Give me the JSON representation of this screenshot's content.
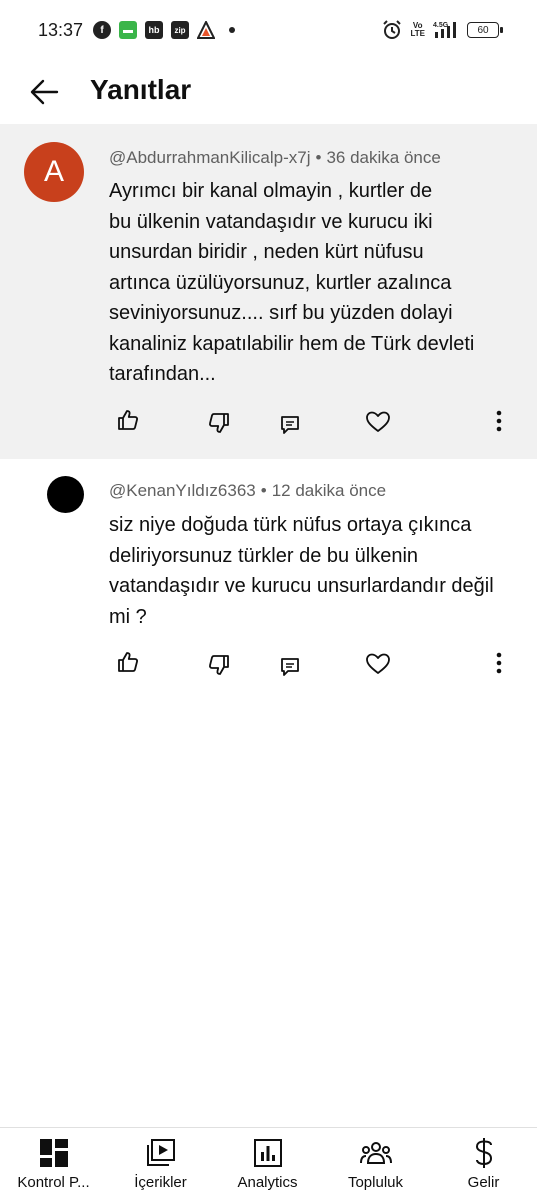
{
  "status_bar": {
    "time": "13:37",
    "battery": "60",
    "network": "4.5G",
    "volte": "Vo LTE"
  },
  "header": {
    "title": "Yanıtlar"
  },
  "comments": [
    {
      "avatar_letter": "A",
      "avatar_color": "#c8401c",
      "author": "@AbdurrahmanKilicalp-x7j",
      "separator": "•",
      "time": "36 dakika önce",
      "lines": [
        "Ayrımcı bir kanal olmayin , kurtler de",
        "bu ülkenin vatandaşıdır ve kurucu iki",
        "unsurdan biridir , neden kürt nüfusu",
        "artınca üzülüyorsunuz,  kurtler azalınca",
        "seviniyorsunuz.... sırf bu yüzden dolayi",
        "kanaliniz kapatılabilir hem de Türk devleti",
        "tarafından..."
      ]
    },
    {
      "avatar_letter": "",
      "avatar_color": "#000000",
      "author": "@KenanYıldız6363",
      "separator": "•",
      "time": "12 dakika önce",
      "lines": [
        "siz niye doğuda türk nüfus ortaya çıkınca",
        "deliriyorsunuz türkler de bu ülkenin",
        "vatandaşıdır ve kurucu unsurlardandır değil",
        "mi ?"
      ]
    }
  ],
  "bottom_nav": [
    {
      "label": "Kontrol P...",
      "icon": "dashboard-icon"
    },
    {
      "label": "İçerikler",
      "icon": "content-icon"
    },
    {
      "label": "Analytics",
      "icon": "analytics-icon"
    },
    {
      "label": "Topluluk",
      "icon": "community-icon"
    },
    {
      "label": "Gelir",
      "icon": "dollar-icon"
    }
  ]
}
